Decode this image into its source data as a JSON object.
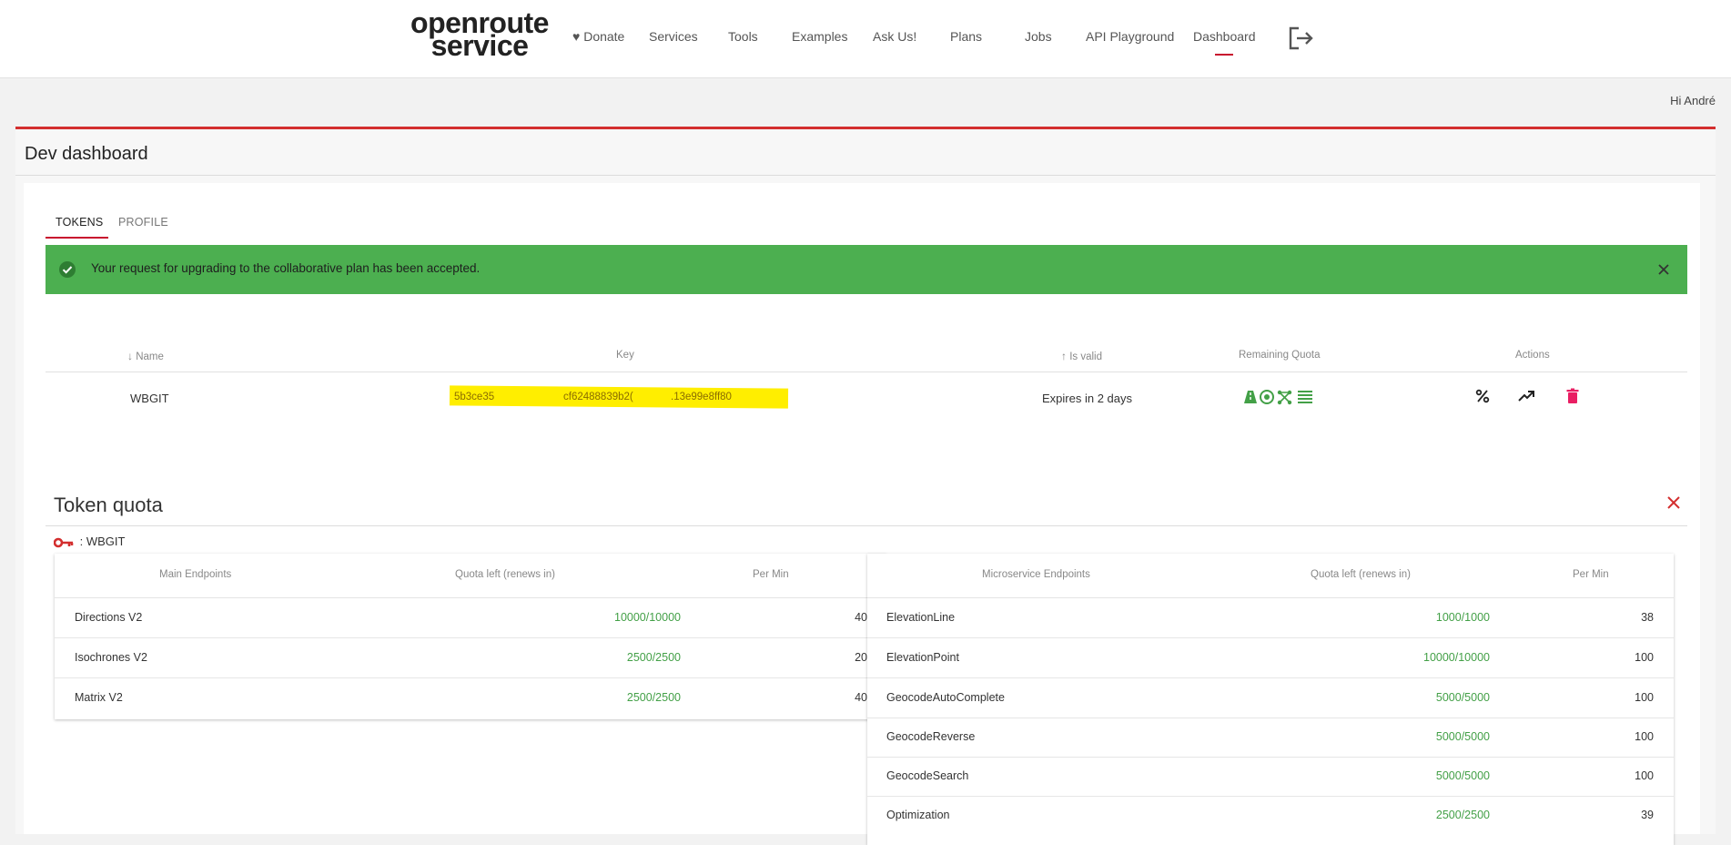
{
  "nav": {
    "logo_line1": "openroute",
    "logo_line2": "service",
    "items": [
      {
        "label": "♥ Donate"
      },
      {
        "label": "Services"
      },
      {
        "label": "Tools"
      },
      {
        "label": "Examples"
      },
      {
        "label": "Ask Us!"
      },
      {
        "label": "Plans"
      },
      {
        "label": "Jobs"
      },
      {
        "label": "API Playground"
      },
      {
        "label": "Dashboard",
        "active": true
      }
    ],
    "logout_icon": "logout-icon"
  },
  "greeting": "Hi André",
  "dashboard": {
    "title": "Dev dashboard",
    "tabs": [
      {
        "label": "TOKENS",
        "active": true
      },
      {
        "label": "PROFILE",
        "active": false
      }
    ],
    "alert": {
      "text": "Your request for upgrading to the collaborative plan has been accepted.",
      "color": "#4caf50"
    },
    "tokens_table": {
      "headers": {
        "name": "Name",
        "key": "Key",
        "is_valid": "Is valid",
        "remaining_quota": "Remaining Quota",
        "actions": "Actions"
      },
      "rows": [
        {
          "name": "WBGIT",
          "key_parts": [
            "5b3ce35",
            "cf62488839b2(",
            ".13e99e8ff80"
          ],
          "validity": "Expires in 2 days"
        }
      ]
    },
    "token_quota": {
      "title": "Token quota",
      "key_label": ": WBGIT",
      "main": {
        "headers": [
          "Main Endpoints",
          "Quota left (renews in)",
          "Per Min"
        ],
        "rows": [
          {
            "name": "Directions V2",
            "quota": "10000/10000",
            "per_min": "40"
          },
          {
            "name": "Isochrones V2",
            "quota": "2500/2500",
            "per_min": "20"
          },
          {
            "name": "Matrix V2",
            "quota": "2500/2500",
            "per_min": "40"
          }
        ]
      },
      "micro": {
        "headers": [
          "Microservice Endpoints",
          "Quota left (renews in)",
          "Per Min"
        ],
        "rows": [
          {
            "name": "ElevationLine",
            "quota": "1000/1000",
            "per_min": "38"
          },
          {
            "name": "ElevationPoint",
            "quota": "10000/10000",
            "per_min": "100"
          },
          {
            "name": "GeocodeAutoComplete",
            "quota": "5000/5000",
            "per_min": "100"
          },
          {
            "name": "GeocodeReverse",
            "quota": "5000/5000",
            "per_min": "100"
          },
          {
            "name": "GeocodeSearch",
            "quota": "5000/5000",
            "per_min": "100"
          },
          {
            "name": "Optimization",
            "quota": "2500/2500",
            "per_min": "39"
          }
        ]
      }
    }
  },
  "colors": {
    "accent": "#c8102e",
    "success": "#4caf50",
    "quota_green": "#43a047",
    "delete": "#e91e63",
    "key_highlight": "#ffee00"
  }
}
